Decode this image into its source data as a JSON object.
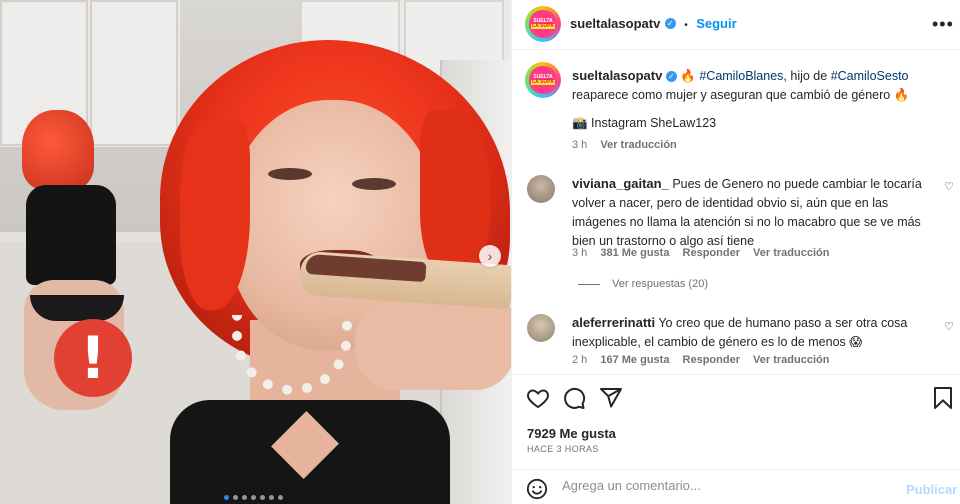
{
  "post": {
    "username": "sueltalasopatv",
    "follow_label": "Seguir",
    "separator": "•",
    "caption_part1": "🔥 ",
    "caption_tag1": "#CamiloBlanes",
    "caption_part2": ", hijo de ",
    "caption_tag2": "#CamiloSesto",
    "caption_part3": "reaparece como mujer y aseguran que cambió de género 🔥",
    "credit": "📸 Instagram SheLaw123",
    "caption_time": "3 h",
    "caption_translate": "Ver traducción",
    "likes": "7929 Me gusta",
    "posted_ago": "HACE 3 HORAS"
  },
  "avatar_logo": {
    "line1": "SUELTA",
    "line2": "LA SOPA"
  },
  "comments": [
    {
      "username": "viviana_gaitan_",
      "text": "Pues de Genero no puede cambiar le tocaría volver a nacer, pero de identidad obvio si, aún que en las imágenes no llama la atención si no lo macabro que se ve más bien un trastorno o algo así tiene",
      "time": "3 h",
      "likes": "381 Me gusta",
      "reply": "Responder",
      "translate": "Ver traducción",
      "replies_label": "Ver respuestas (20)"
    },
    {
      "username": "aleferrerinatti",
      "text": "Yo creo que de humano paso a ser otra cosa inexplicable, el cambio de género es lo de menos 😱",
      "time": "2 h",
      "likes": "167 Me gusta",
      "reply": "Responder",
      "translate": "Ver traducción"
    }
  ],
  "comment_box": {
    "placeholder": "Agrega un comentario...",
    "publish_label": "Publicar"
  },
  "icons": {
    "more": "more-options-icon",
    "like": "heart-icon",
    "comment": "comment-icon",
    "share": "send-icon",
    "save": "bookmark-icon",
    "emoji": "emoji-icon",
    "warning": "warning-icon",
    "next": "chevron-right-icon"
  },
  "colors": {
    "accent": "#0095f6",
    "warning": "#e24033",
    "hashtag": "#00376b",
    "hair": "#e8311a"
  },
  "carousel": {
    "total_slides": 7,
    "active_index": 0
  }
}
